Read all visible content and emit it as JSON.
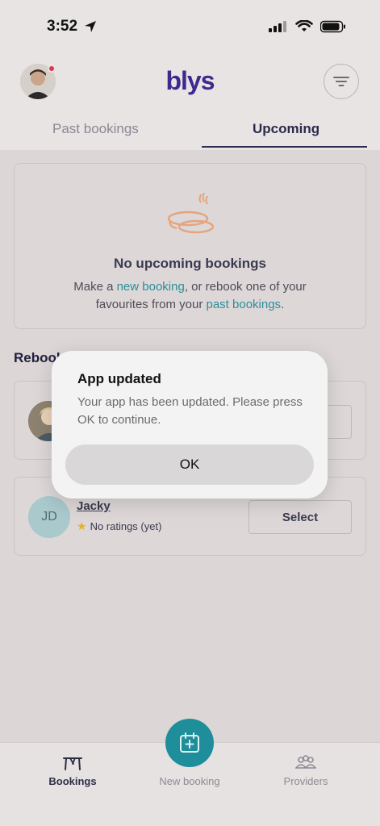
{
  "status_bar": {
    "time": "3:52"
  },
  "header": {
    "logo": "blys"
  },
  "tabs": [
    {
      "label": "Past bookings",
      "active": false
    },
    {
      "label": "Upcoming",
      "active": true
    }
  ],
  "empty_state": {
    "title": "No upcoming bookings",
    "text_1": "Make a ",
    "link_1": "new booking",
    "text_2": ", or rebook one of your favourites from your ",
    "link_2": "past bookings",
    "text_3": "."
  },
  "rebook": {
    "title": "Rebook",
    "providers": [
      {
        "name": "Jacky",
        "initials": "JD",
        "rating_text": "No ratings (yet)",
        "select_label": "Select"
      }
    ]
  },
  "dialog": {
    "title": "App updated",
    "message": "Your app has been updated. Please press OK to continue.",
    "ok_label": "OK"
  },
  "bottom_nav": {
    "bookings": "Bookings",
    "new_booking": "New booking",
    "providers": "Providers"
  },
  "colors": {
    "brand": "#3c2a8f",
    "accent": "#1e8e9b",
    "link": "#2a8f9a",
    "notification": "#e0344f"
  }
}
